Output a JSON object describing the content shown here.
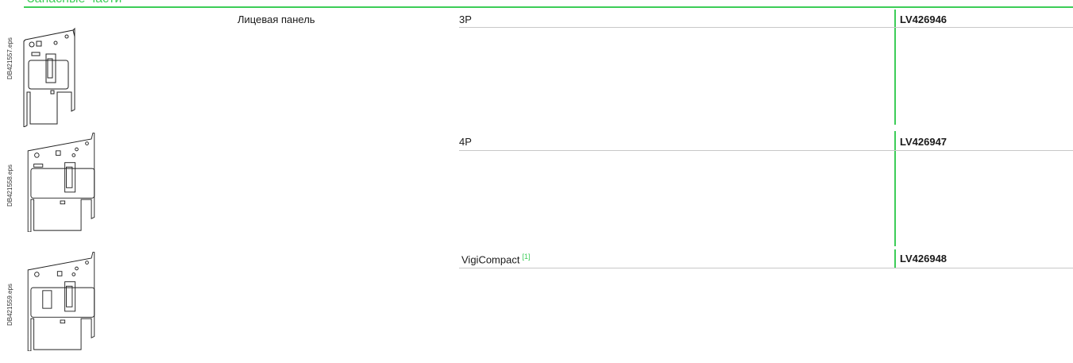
{
  "header": {
    "heading_fragment": "Запасные части"
  },
  "product": {
    "description": "Лицевая панель"
  },
  "rows": [
    {
      "label": "3P",
      "reference": "LV426946",
      "drawing_code": "DB421557.eps"
    },
    {
      "label": "4P",
      "reference": "LV426947",
      "drawing_code": "DB421558.eps"
    },
    {
      "label": "VigiCompact",
      "footnote": "[1]",
      "reference": "LV426948",
      "drawing_code": "DB421559.eps"
    }
  ],
  "colors": {
    "accent": "#3dcd58",
    "text": "#1a1a1a",
    "divider": "#c8c8c8"
  }
}
